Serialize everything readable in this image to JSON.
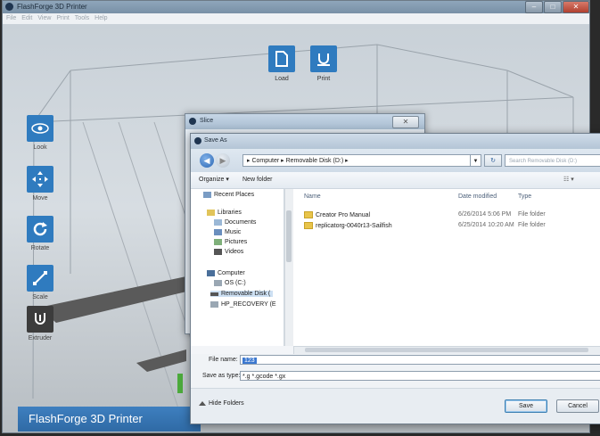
{
  "app": {
    "title": "FlashForge 3D Printer",
    "menu": [
      "File",
      "Edit",
      "View",
      "Print",
      "Tools",
      "Help"
    ],
    "window_controls": [
      "–",
      "□",
      "✕"
    ],
    "brand": "FlashForge 3D Printer"
  },
  "toolbar_top": [
    {
      "label": "Load",
      "icon": "file-icon"
    },
    {
      "label": "Print",
      "icon": "print-icon"
    }
  ],
  "toolbar_left": [
    {
      "label": "Look",
      "icon": "eye-icon"
    },
    {
      "label": "Move",
      "icon": "move-icon"
    },
    {
      "label": "Rotate",
      "icon": "rotate-icon"
    },
    {
      "label": "Scale",
      "icon": "scale-icon"
    },
    {
      "label": "Extruder",
      "icon": "extruder-icon"
    }
  ],
  "slice_dialog": {
    "title": "Slice",
    "close": "✕"
  },
  "save_dialog": {
    "title": "Save As",
    "address": "▸ Computer ▸ Removable Disk (D:) ▸",
    "search_placeholder": "Search Removable Disk (D:)",
    "organize": "Organize ▾",
    "new_folder": "New folder",
    "view_btn": "☷ ▾",
    "nav_items": [
      {
        "label": "Recent Places",
        "icon": "recent-places-icon"
      },
      {
        "label": "Libraries",
        "icon": "libraries-icon"
      },
      {
        "label": "Documents",
        "icon": "documents-icon"
      },
      {
        "label": "Music",
        "icon": "music-icon"
      },
      {
        "label": "Pictures",
        "icon": "pictures-icon"
      },
      {
        "label": "Videos",
        "icon": "videos-icon"
      },
      {
        "label": "Computer",
        "icon": "computer-icon"
      },
      {
        "label": "OS (C:)",
        "icon": "drive-icon"
      },
      {
        "label": "Removable Disk (",
        "icon": "usb-drive-icon"
      },
      {
        "label": "HP_RECOVERY (E",
        "icon": "drive-icon"
      }
    ],
    "columns": {
      "name": "Name",
      "date": "Date modified",
      "type": "Type"
    },
    "files": [
      {
        "name": "Creator Pro Manual",
        "date": "6/26/2014 5:06 PM",
        "type": "File folder"
      },
      {
        "name": "replicatorg-0040r13-Sailfish",
        "date": "6/25/2014 10:20 AM",
        "type": "File folder"
      }
    ],
    "file_name_label": "File name:",
    "file_name_value": "123",
    "save_type_label": "Save as type:",
    "save_type_value": "*.g *.gcode *.gx",
    "hide_folders": "Hide Folders",
    "save_btn": "Save",
    "cancel_btn": "Cancel"
  }
}
